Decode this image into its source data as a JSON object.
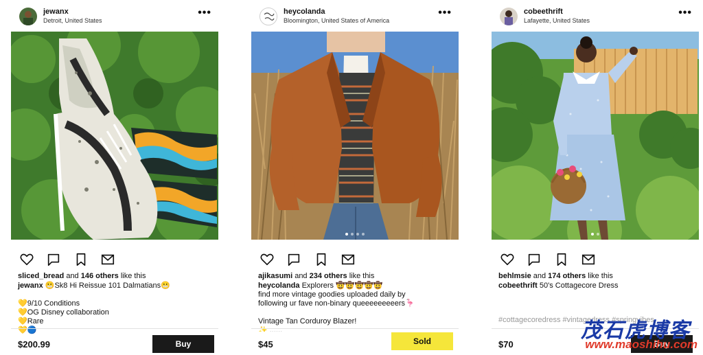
{
  "accent_color": "#f5e63a",
  "posts": [
    {
      "username": "jewanx",
      "location": "Detroit, United States",
      "more_icon": "•••",
      "likes": {
        "user": "sliced_bread",
        "and": " and ",
        "count": "146 others",
        "suffix": " like this"
      },
      "caption_user": "jewanx",
      "caption_text": " 😬Sk8 Hi Reissue 101 Dalmatians😬",
      "details": [
        "💛9/10 Conditions",
        "💛OG Disney collaboration",
        "💛Rare",
        "💛🔵"
      ],
      "price": "$200.99",
      "button_label": "Buy"
    },
    {
      "username": "heycolanda",
      "location": "Bloomington, United States of America",
      "more_icon": "•••",
      "likes": {
        "user": "ajikasumi",
        "and": " and ",
        "count": "234 others",
        "suffix": " like this"
      },
      "caption_user": "heycolanda",
      "caption_text": " Explorers 🤠🤠🤠🤠🤠",
      "details": [
        "find more vintage goodies uploaded daily by",
        "following ur fave non-binary queeeeeeeeers🦩",
        "",
        "Vintage Tan Corduroy Blazer!",
        "✨ ......"
      ],
      "price": "$45",
      "button_label": "Sold"
    },
    {
      "username": "cobeethrift",
      "location": "Lafayette, United States",
      "more_icon": "•••",
      "likes": {
        "user": "behlmsie",
        "and": " and ",
        "count": "174 others",
        "suffix": " like this"
      },
      "caption_user": "cobeethrift",
      "caption_text": " 50's Cottagecore Dress",
      "hashtags": "#cottagecoredress #vintagedress #springvibes",
      "price": "$70",
      "button_label": "Buy"
    }
  ],
  "watermark": {
    "title": "茂石虎博客",
    "url": "www.maoshihu.com"
  }
}
